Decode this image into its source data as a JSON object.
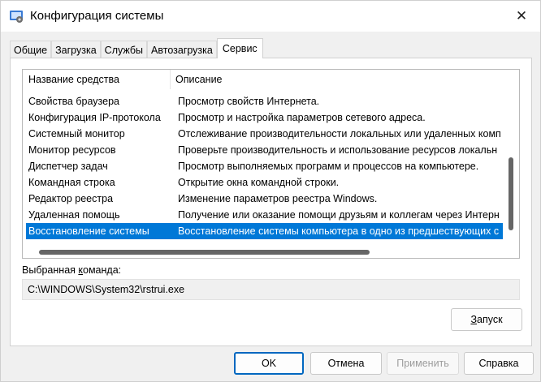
{
  "window": {
    "title": "Конфигурация системы",
    "close_icon": "close-icon"
  },
  "tabs": [
    {
      "label": "Общие",
      "active": false
    },
    {
      "label": "Загрузка",
      "active": false
    },
    {
      "label": "Службы",
      "active": false
    },
    {
      "label": "Автозагрузка",
      "active": false
    },
    {
      "label": "Сервис",
      "active": true
    }
  ],
  "tools_list": {
    "col_name": "Название средства",
    "col_desc": "Описание",
    "rows": [
      {
        "name": "Свойства браузера",
        "desc": "Просмотр свойств Интернета."
      },
      {
        "name": "Конфигурация IP-протокола",
        "desc": "Просмотр и настройка параметров сетевого адреса."
      },
      {
        "name": "Системный монитор",
        "desc": "Отслеживание производительности локальных или удаленных комп"
      },
      {
        "name": "Монитор ресурсов",
        "desc": "Проверьте производительность и использование ресурсов локальн"
      },
      {
        "name": "Диспетчер задач",
        "desc": "Просмотр выполняемых программ и процессов на компьютере."
      },
      {
        "name": "Командная строка",
        "desc": "Открытие окна командной строки."
      },
      {
        "name": "Редактор реестра",
        "desc": "Изменение параметров реестра Windows."
      },
      {
        "name": "Удаленная помощь",
        "desc": "Получение или оказание помощи друзьям и коллегам через Интерн"
      },
      {
        "name": "Восстановление системы",
        "desc": "Восстановление системы компьютера в одно из предшествующих с",
        "selected": true
      }
    ]
  },
  "selected_command": {
    "label_before": "Выбранная ",
    "label_underlined": "к",
    "label_after": "оманда:",
    "value": "C:\\WINDOWS\\System32\\rstrui.exe"
  },
  "launch_button": {
    "underlined": "З",
    "rest": "апуск"
  },
  "footer": {
    "ok": "OK",
    "cancel": "Отмена",
    "apply": "Применить",
    "help": "Справка"
  },
  "colors": {
    "selection": "#0078d7",
    "accent": "#0067c0"
  }
}
